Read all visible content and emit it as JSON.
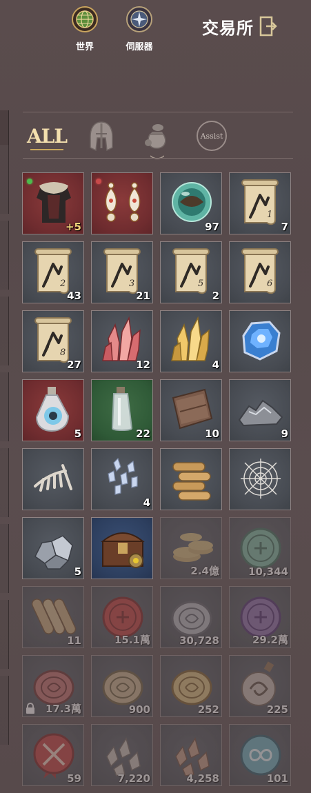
{
  "top": {
    "world_label": "世界",
    "server_label": "伺服器",
    "exchange_label": "交易所"
  },
  "tabs": [
    {
      "label": "ALL",
      "icon": "all-text",
      "active": true
    },
    {
      "label": "",
      "icon": "helmet-icon",
      "active": false
    },
    {
      "label": "",
      "icon": "pouch-icon",
      "active": false
    },
    {
      "label": "Assist",
      "icon": "assist-icon",
      "active": false
    }
  ],
  "items": [
    {
      "icon": "fur-cloak-armor-icon",
      "bg": "red",
      "count": "+5",
      "gold": true,
      "dot": "#4dbb4d"
    },
    {
      "icon": "earrings-icon",
      "bg": "red",
      "count": "",
      "dot": "#c84a4a"
    },
    {
      "icon": "green-orb-icon",
      "bg": "grey",
      "count": "97"
    },
    {
      "icon": "scroll-1-icon",
      "bg": "grey",
      "count": "7",
      "scroll_num": "1"
    },
    {
      "icon": "scroll-2-icon",
      "bg": "grey",
      "count": "43",
      "scroll_num": "2"
    },
    {
      "icon": "scroll-3-icon",
      "bg": "grey",
      "count": "21",
      "scroll_num": "3"
    },
    {
      "icon": "scroll-5-icon",
      "bg": "grey",
      "count": "2",
      "scroll_num": "5"
    },
    {
      "icon": "scroll-6-icon",
      "bg": "grey",
      "count": "",
      "scroll_num": "6"
    },
    {
      "icon": "scroll-8-icon",
      "bg": "grey",
      "count": "27",
      "scroll_num": "8"
    },
    {
      "icon": "red-crystal-icon",
      "bg": "grey",
      "count": "12"
    },
    {
      "icon": "gold-crystal-icon",
      "bg": "grey",
      "count": "4"
    },
    {
      "icon": "blue-gem-icon",
      "bg": "grey",
      "count": ""
    },
    {
      "icon": "eye-potion-icon",
      "bg": "red",
      "count": "5"
    },
    {
      "icon": "empty-vial-icon",
      "bg": "green",
      "count": "22"
    },
    {
      "icon": "leather-icon",
      "bg": "grey",
      "count": "10"
    },
    {
      "icon": "ore-pile-icon",
      "bg": "grey",
      "count": "9"
    },
    {
      "icon": "bones-icon",
      "bg": "grey",
      "count": ""
    },
    {
      "icon": "crystal-shards-icon",
      "bg": "grey",
      "count": "4"
    },
    {
      "icon": "logs-icon",
      "bg": "grey",
      "count": ""
    },
    {
      "icon": "spider-web-icon",
      "bg": "grey",
      "count": ""
    },
    {
      "icon": "silver-ore-icon",
      "bg": "grey",
      "count": "5"
    },
    {
      "icon": "treasure-chest-icon",
      "bg": "blue",
      "count": ""
    },
    {
      "icon": "coin-stack-icon",
      "bg": "grey",
      "count": "2.4億",
      "dim": true
    },
    {
      "icon": "green-seal-icon",
      "bg": "grey",
      "count": "10,344",
      "dim": true
    },
    {
      "icon": "scroll-bundle-icon",
      "bg": "grey",
      "count": "11",
      "dim": true
    },
    {
      "icon": "red-wax-seal-icon",
      "bg": "grey",
      "count": "15.1萬",
      "dim": true
    },
    {
      "icon": "silver-coin-icon",
      "bg": "grey",
      "count": "30,728",
      "dim": true
    },
    {
      "icon": "purple-seal-icon",
      "bg": "grey",
      "count": "29.2萬",
      "dim": true
    },
    {
      "icon": "red-coin-icon",
      "bg": "grey",
      "count": "17.3萬",
      "dim": true,
      "locked": true
    },
    {
      "icon": "bronze-coin-icon",
      "bg": "grey",
      "count": "900",
      "dim": true
    },
    {
      "icon": "gold-coin-icon",
      "bg": "grey",
      "count": "252",
      "dim": true
    },
    {
      "icon": "swirl-flask-icon",
      "bg": "grey",
      "count": "225",
      "dim": true
    },
    {
      "icon": "crossed-swords-seal-icon",
      "bg": "grey",
      "count": "59",
      "dim": true
    },
    {
      "icon": "stone-shards-icon",
      "bg": "grey",
      "count": "7,220",
      "dim": true
    },
    {
      "icon": "copper-shards-icon",
      "bg": "grey",
      "count": "4,258",
      "dim": true
    },
    {
      "icon": "infinity-seal-icon",
      "bg": "grey",
      "count": "101",
      "dim": true
    }
  ]
}
